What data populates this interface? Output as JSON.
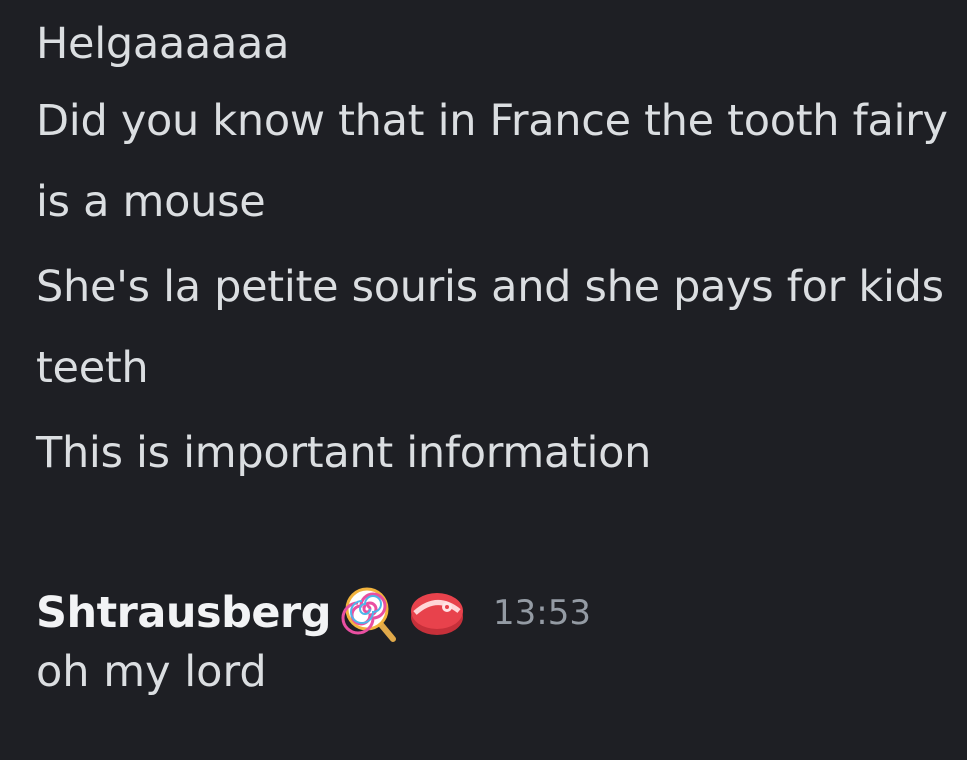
{
  "previous_messages": [
    "Helgaaaaaa",
    "Did you know that in France the tooth fairy is a mouse",
    "She's la petite souris and she pays for kids teeth",
    "This is important information"
  ],
  "message_group": {
    "username": "Shtrausberg",
    "badges": [
      "lollipop-emoji",
      "meat-emoji"
    ],
    "timestamp": "13:53",
    "text": "oh my lord"
  },
  "colors": {
    "background": "#1e1f24",
    "message_text": "#dbdee1",
    "username": "#f2f3f5",
    "timestamp": "#949ba4"
  }
}
